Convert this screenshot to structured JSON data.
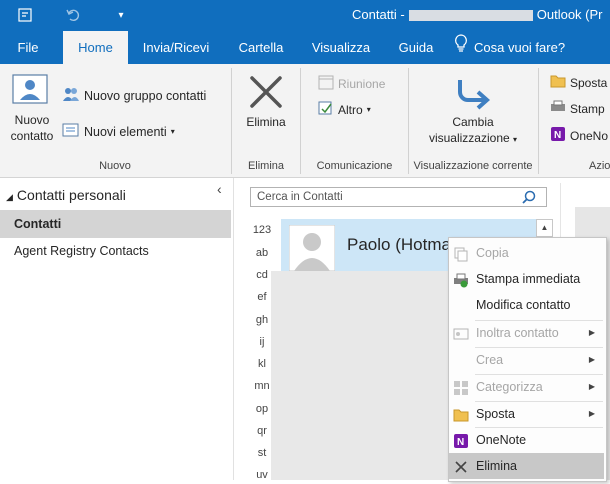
{
  "titlebar": {
    "title_prefix": "Contatti -",
    "title_suffix": "Outlook (Pr",
    "quick_access": [
      "sync-icon",
      "undo-icon",
      "customize-icon"
    ]
  },
  "tabs": [
    {
      "label": "File",
      "active": false
    },
    {
      "label": "Home",
      "active": true
    },
    {
      "label": "Invia/Ricevi",
      "active": false
    },
    {
      "label": "Cartella",
      "active": false
    },
    {
      "label": "Visualizza",
      "active": false
    },
    {
      "label": "Guida",
      "active": false
    }
  ],
  "tell_me": "Cosa vuoi fare?",
  "ribbon": {
    "nuovo": {
      "new_contact": "Nuovo contatto",
      "new_contact_line1": "Nuovo",
      "new_contact_line2": "contatto",
      "new_group": "Nuovo gruppo contatti",
      "new_items": "Nuovi elementi",
      "group_label": "Nuovo"
    },
    "elimina": {
      "delete": "Elimina",
      "group_label": "Elimina"
    },
    "comunicazione": {
      "meeting": "Riunione",
      "more": "Altro",
      "group_label": "Comunicazione"
    },
    "vista": {
      "change_view_line1": "Cambia",
      "change_view_line2": "visualizzazione",
      "group_label": "Visualizzazione corrente"
    },
    "azioni": {
      "move": "Sposta",
      "print": "Stamp",
      "onenote": "OneNo",
      "group_label": "Azio"
    }
  },
  "leftpane": {
    "header": "Contatti personali",
    "items": [
      {
        "label": "Contatti",
        "selected": true
      },
      {
        "label": "Agent Registry Contacts",
        "selected": false
      }
    ]
  },
  "search": {
    "placeholder": "Cerca in Contatti"
  },
  "letters": [
    "123",
    "ab",
    "cd",
    "ef",
    "gh",
    "ij",
    "kl",
    "mn",
    "op",
    "qr",
    "st",
    "uv"
  ],
  "contact_card": {
    "name": "Paolo (Hotma"
  },
  "context_menu": {
    "items": [
      {
        "label": "Copia",
        "disabled": true,
        "submenu": false,
        "icon": "copy-icon"
      },
      {
        "label": "Stampa immediata",
        "disabled": false,
        "submenu": false,
        "icon": "quick-print-icon"
      },
      {
        "label": "Modifica contatto",
        "disabled": false,
        "submenu": false,
        "icon": ""
      },
      {
        "label": "Inoltra contatto",
        "disabled": true,
        "submenu": true,
        "icon": "forward-contact-icon"
      },
      {
        "label": "Crea",
        "disabled": true,
        "submenu": true,
        "icon": ""
      },
      {
        "label": "Categorizza",
        "disabled": true,
        "submenu": true,
        "icon": "categorize-icon"
      },
      {
        "label": "Sposta",
        "disabled": false,
        "submenu": true,
        "icon": "folder-icon"
      },
      {
        "label": "OneNote",
        "disabled": false,
        "submenu": false,
        "icon": "onenote-icon"
      },
      {
        "label": "Elimina",
        "disabled": false,
        "submenu": false,
        "highlighted": true,
        "icon": "delete-x-icon"
      }
    ]
  },
  "colors": {
    "brand": "#106ebe",
    "ribbon_bg": "#f3f3f3",
    "card_selected": "#cde6f7",
    "onenote": "#7719aa"
  }
}
